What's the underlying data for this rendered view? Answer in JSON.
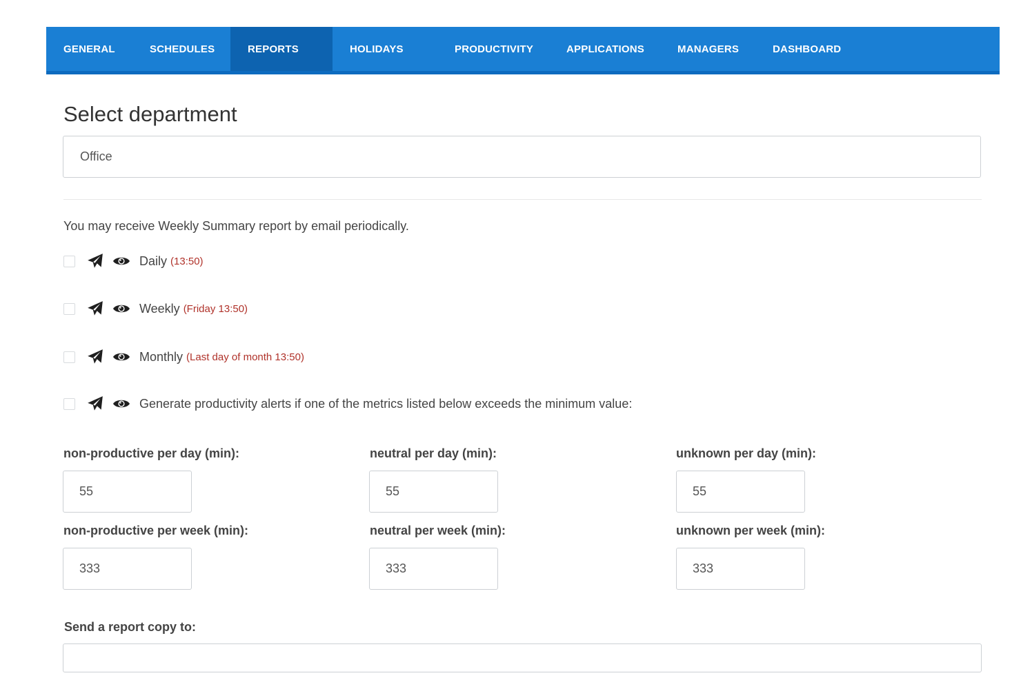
{
  "nav": {
    "tabs": [
      {
        "label": "GENERAL"
      },
      {
        "label": "SCHEDULES"
      },
      {
        "label": "REPORTS"
      },
      {
        "label": "HOLIDAYS"
      },
      {
        "label": "PRODUCTIVITY"
      },
      {
        "label": "APPLICATIONS"
      },
      {
        "label": "MANAGERS"
      },
      {
        "label": "DASHBOARD"
      }
    ],
    "active_tab": "REPORTS",
    "color": "#1a7fd4",
    "active_color": "#0d63b0"
  },
  "department": {
    "title": "Select department",
    "selected": "Office"
  },
  "reports": {
    "intro": "You may receive Weekly Summary report by email periodically.",
    "items": [
      {
        "label": "Daily",
        "schedule": "(13:50)",
        "checked": false,
        "icons": [
          "send-icon",
          "eye-icon"
        ]
      },
      {
        "label": "Weekly",
        "schedule": "(Friday 13:50)",
        "checked": false,
        "icons": [
          "send-icon",
          "eye-icon"
        ]
      },
      {
        "label": "Monthly",
        "schedule": "(Last day of month 13:50)",
        "checked": false,
        "icons": [
          "send-icon",
          "eye-icon"
        ]
      },
      {
        "label": "Generate productivity alerts if one of the metrics listed below exceeds the minimum value:",
        "schedule": "",
        "checked": false,
        "icons": [
          "send-icon",
          "eye-icon"
        ]
      }
    ],
    "schedule_color": "#b0322a"
  },
  "metrics": {
    "non_productive_day": {
      "label": "non-productive per day (min):",
      "value": "55"
    },
    "neutral_day": {
      "label": "neutral per day (min):",
      "value": "55"
    },
    "unknown_day": {
      "label": "unknown per day (min):",
      "value": "55"
    },
    "non_productive_week": {
      "label": "non-productive per week (min):",
      "value": "333"
    },
    "neutral_week": {
      "label": "neutral per week (min):",
      "value": "333"
    },
    "unknown_week": {
      "label": "unknown per week (min):",
      "value": "333"
    }
  },
  "copy": {
    "label": "Send a report copy to:",
    "value": ""
  }
}
